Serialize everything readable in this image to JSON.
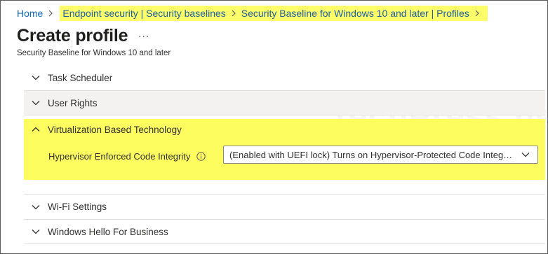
{
  "breadcrumb": {
    "home": "Home",
    "endpoint": "Endpoint security | Security baselines",
    "baseline": "Security Baseline for Windows 10 and later | Profiles"
  },
  "page": {
    "title": "Create profile",
    "more": "...",
    "subtitle": "Security Baseline for Windows 10 and later"
  },
  "sections": {
    "task_scheduler": "Task Scheduler",
    "user_rights": "User Rights",
    "virtualization": "Virtualization Based Technology",
    "wifi": "Wi-Fi Settings",
    "hello": "Windows Hello For Business"
  },
  "setting": {
    "label": "Hypervisor Enforced Code Integrity",
    "value": "(Enabled with UEFI lock) Turns on Hypervisor-Protected Code Integrity"
  },
  "watermark": "TechPress.net",
  "colors": {
    "link": "#0f6cbd",
    "highlight": "#fdfd60",
    "text": "#323130"
  }
}
